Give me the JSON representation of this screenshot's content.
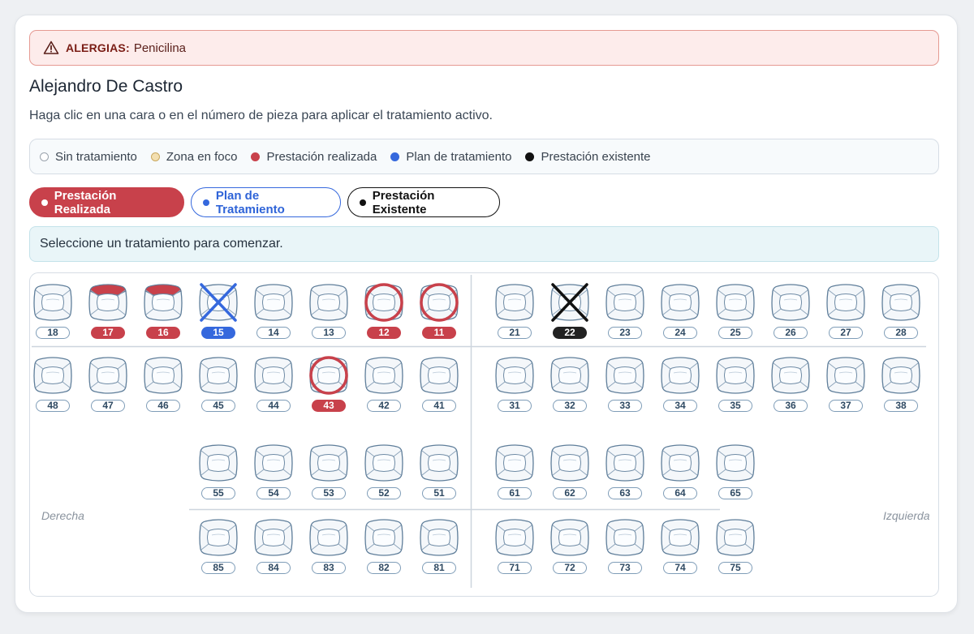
{
  "alert": {
    "label": "ALERGIAS:",
    "value": "Penicilina",
    "icon": "warning-triangle-icon"
  },
  "patient": {
    "name": "Alejandro De Castro"
  },
  "hint": "Haga clic en una cara o en el número de pieza para aplicar el tratamiento activo.",
  "legend": [
    {
      "label": "Sin tratamiento",
      "color": "#ffffff"
    },
    {
      "label": "Zona en foco",
      "color": "#f3dfb0"
    },
    {
      "label": "Prestación realizada",
      "color": "#c8414b"
    },
    {
      "label": "Plan de tratamiento",
      "color": "#3568dd"
    },
    {
      "label": "Prestación existente",
      "color": "#111111"
    }
  ],
  "buttons": {
    "realizada": "Prestación Realizada",
    "plan": "Plan de Tratamiento",
    "existente": "Prestación Existente"
  },
  "info": "Seleccione un tratamiento para comenzar.",
  "sides": {
    "right": "Derecha",
    "left": "Izquierda"
  },
  "colors": {
    "realizada": "#c8414b",
    "plan": "#3568dd",
    "existente": "#111111"
  },
  "teeth": {
    "upper_right": [
      {
        "n": "18"
      },
      {
        "n": "17",
        "face": "top",
        "color": "red"
      },
      {
        "n": "16",
        "face": "top",
        "color": "red"
      },
      {
        "n": "15",
        "mark": "x",
        "color": "blue"
      },
      {
        "n": "14"
      },
      {
        "n": "13"
      },
      {
        "n": "12",
        "mark": "circle",
        "color": "red"
      },
      {
        "n": "11",
        "mark": "circle",
        "color": "red"
      }
    ],
    "upper_left": [
      {
        "n": "21"
      },
      {
        "n": "22",
        "mark": "x",
        "color": "black"
      },
      {
        "n": "23"
      },
      {
        "n": "24"
      },
      {
        "n": "25"
      },
      {
        "n": "26"
      },
      {
        "n": "27"
      },
      {
        "n": "28"
      }
    ],
    "lower_right": [
      {
        "n": "48"
      },
      {
        "n": "47"
      },
      {
        "n": "46"
      },
      {
        "n": "45"
      },
      {
        "n": "44"
      },
      {
        "n": "43",
        "mark": "circle",
        "color": "red"
      },
      {
        "n": "42"
      },
      {
        "n": "41"
      }
    ],
    "lower_left": [
      {
        "n": "31"
      },
      {
        "n": "32"
      },
      {
        "n": "33"
      },
      {
        "n": "34"
      },
      {
        "n": "35"
      },
      {
        "n": "36"
      },
      {
        "n": "37"
      },
      {
        "n": "38"
      }
    ],
    "child_upper_right": [
      {
        "n": "55"
      },
      {
        "n": "54"
      },
      {
        "n": "53"
      },
      {
        "n": "52"
      },
      {
        "n": "51"
      }
    ],
    "child_upper_left": [
      {
        "n": "61"
      },
      {
        "n": "62"
      },
      {
        "n": "63"
      },
      {
        "n": "64"
      },
      {
        "n": "65"
      }
    ],
    "child_lower_right": [
      {
        "n": "85"
      },
      {
        "n": "84"
      },
      {
        "n": "83"
      },
      {
        "n": "82"
      },
      {
        "n": "81"
      }
    ],
    "child_lower_left": [
      {
        "n": "71"
      },
      {
        "n": "72"
      },
      {
        "n": "73"
      },
      {
        "n": "74"
      },
      {
        "n": "75"
      }
    ]
  }
}
